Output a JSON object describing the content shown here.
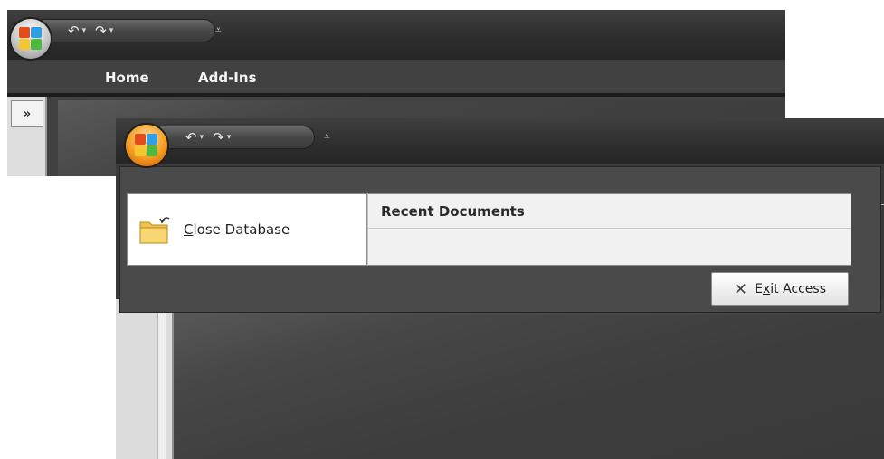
{
  "background_window": {
    "quick_access": {
      "undo": "↶",
      "redo": "↷",
      "dropdown": "▾",
      "customize": "⩡"
    },
    "shutter_bar_label": "»",
    "ribbon_tabs": [
      "Home",
      "Add-Ins"
    ]
  },
  "foreground_window": {
    "quick_access": {
      "undo": "↶",
      "redo": "↷",
      "dropdown": "▾",
      "customize": "⩡"
    },
    "office_menu": {
      "close_database": {
        "accel": "C",
        "rest": "lose Database"
      },
      "recent_documents_header": "Recent Documents",
      "exit_button": {
        "pre": "E",
        "accel": "x",
        "rest": "it Access",
        "icon": "✕"
      }
    }
  },
  "icons": {
    "office_button": "office-logo-icon",
    "folder": "folder-icon",
    "exit": "close-x-icon"
  },
  "colors": {
    "title_bar": "#2c2c2c",
    "orb_active": "#f59b22",
    "menu_panel": "#4a4a4a",
    "workspace": "#3d3d3d"
  }
}
